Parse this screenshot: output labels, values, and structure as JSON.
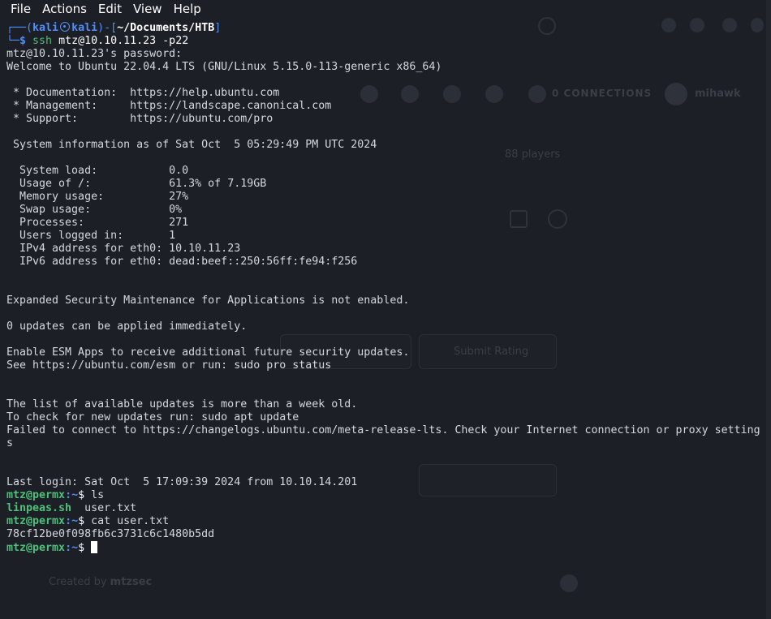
{
  "menubar": {
    "items": [
      "File",
      "Actions",
      "Edit",
      "View",
      "Help"
    ]
  },
  "background_ghost": {
    "connections": "0 CONNECTIONS",
    "username": "mihawk",
    "players": "88 players",
    "submit_rating": "Submit Rating",
    "created_by_prefix": "Created by",
    "created_by_user": "mtzsec"
  },
  "prompt": {
    "user": "kali",
    "host": "kali",
    "cwd": "~/Documents/HTB",
    "command": "ssh",
    "args": "mtz@10.10.11.23 -p22"
  },
  "ssh": {
    "password_prompt": "mtz@10.10.11.23's password:",
    "welcome": "Welcome to Ubuntu 22.04.4 LTS (GNU/Linux 5.15.0-113-generic x86_64)",
    "links": [
      {
        "label": " * Documentation:",
        "url": "https://help.ubuntu.com"
      },
      {
        "label": " * Management:",
        "url": "https://landscape.canonical.com"
      },
      {
        "label": " * Support:",
        "url": "https://ubuntu.com/pro"
      }
    ],
    "sysinfo_header": " System information as of Sat Oct  5 05:29:49 PM UTC 2024",
    "sysinfo": [
      {
        "label": "  System load:",
        "value": "0.0"
      },
      {
        "label": "  Usage of /:",
        "value": "61.3% of 7.19GB"
      },
      {
        "label": "  Memory usage:",
        "value": "27%"
      },
      {
        "label": "  Swap usage:",
        "value": "0%"
      },
      {
        "label": "  Processes:",
        "value": "271"
      },
      {
        "label": "  Users logged in:",
        "value": "1"
      },
      {
        "label": "  IPv4 address for eth0:",
        "value": "10.10.11.23"
      },
      {
        "label": "  IPv6 address for eth0:",
        "value": "dead:beef::250:56ff:fe94:f256"
      }
    ],
    "esm_notice": "Expanded Security Maintenance for Applications is not enabled.",
    "updates_notice": "0 updates can be applied immediately.",
    "esm_enable": "Enable ESM Apps to receive additional future security updates.",
    "esm_see": "See https://ubuntu.com/esm or run: sudo pro status",
    "old_list": "The list of available updates is more than a week old.",
    "check_updates": "To check for new updates run: sudo apt update",
    "failed_connect": "Failed to connect to https://changelogs.ubuntu.com/meta-release-lts. Check your Internet connection or proxy setting",
    "failed_connect_wrap": "s",
    "last_login": "Last login: Sat Oct  5 17:09:39 2024 from 10.10.14.201"
  },
  "remote": {
    "user_host": "mtz@permx",
    "path": ":~",
    "cmd1": "ls",
    "ls_out_script": "linpeas.sh",
    "ls_out_file": "user.txt",
    "cmd2": "cat user.txt",
    "flag": "78cf12be0f098fb6c3731c6c1480b5dd"
  },
  "colors": {
    "background": "#1c1f26",
    "prompt_blue": "#4f8ff7",
    "remote_green": "#4ec07a",
    "text": "#d5d8de"
  }
}
